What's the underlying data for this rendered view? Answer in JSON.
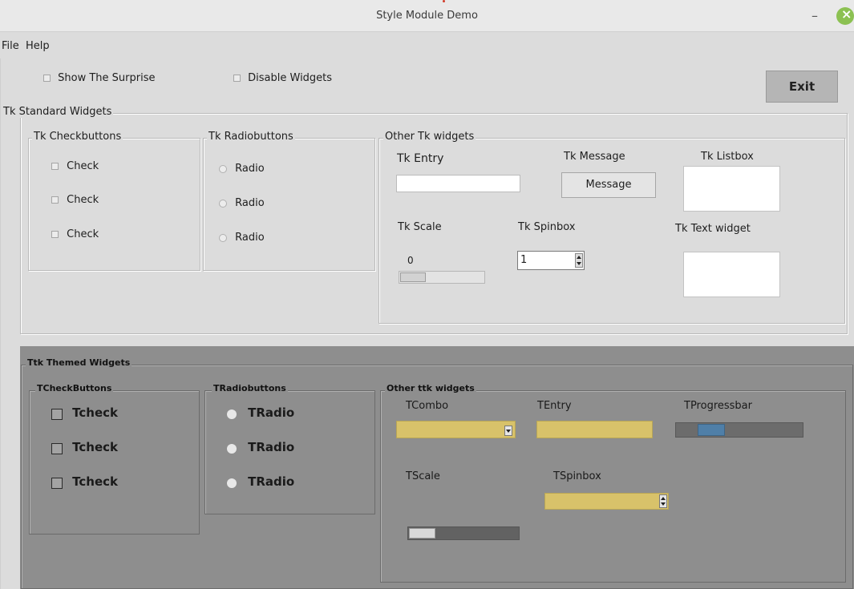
{
  "window": {
    "title": "Style Module Demo",
    "minimize_glyph": "–"
  },
  "menu": {
    "file": "File",
    "help": "Help"
  },
  "top_controls": {
    "show_surprise": "Show The Surprise",
    "disable_widgets": "Disable Widgets",
    "exit": "Exit"
  },
  "tk": {
    "title": "Tk Standard Widgets",
    "checkbuttons": {
      "title": "Tk Checkbuttons",
      "items": [
        "Check",
        "Check",
        "Check"
      ]
    },
    "radiobuttons": {
      "title": "Tk Radiobuttons",
      "items": [
        "Radio",
        "Radio",
        "Radio"
      ]
    },
    "other": {
      "title": "Other Tk widgets",
      "entry_label": "Tk Entry",
      "entry_value": "",
      "message_label": "Tk Message",
      "message_text": "Message",
      "listbox_label": "Tk Listbox",
      "scale_label": "Tk Scale",
      "scale_value": "0",
      "spinbox_label": "Tk Spinbox",
      "spinbox_value": "1",
      "text_label": "Tk Text widget"
    }
  },
  "ttk": {
    "title": "Ttk Themed Widgets",
    "checkbuttons": {
      "title": "TCheckButtons",
      "items": [
        "Tcheck",
        "Tcheck",
        "Tcheck"
      ]
    },
    "radiobuttons": {
      "title": "TRadiobuttons",
      "items": [
        "TRadio",
        "TRadio",
        "TRadio"
      ]
    },
    "other": {
      "title": "Other ttk widgets",
      "combo_label": "TCombo",
      "entry_label": "TEntry",
      "progress_label": "TProgressbar",
      "scale_label": "TScale",
      "spinbox_label": "TSpinbox"
    }
  },
  "colors": {
    "window_bg": "#dcdcdc",
    "ttk_bg": "#8e8e8e",
    "ttk_field": "#d8c26a",
    "progress_fill": "#4f7fa8",
    "close_button": "#8cc152"
  }
}
